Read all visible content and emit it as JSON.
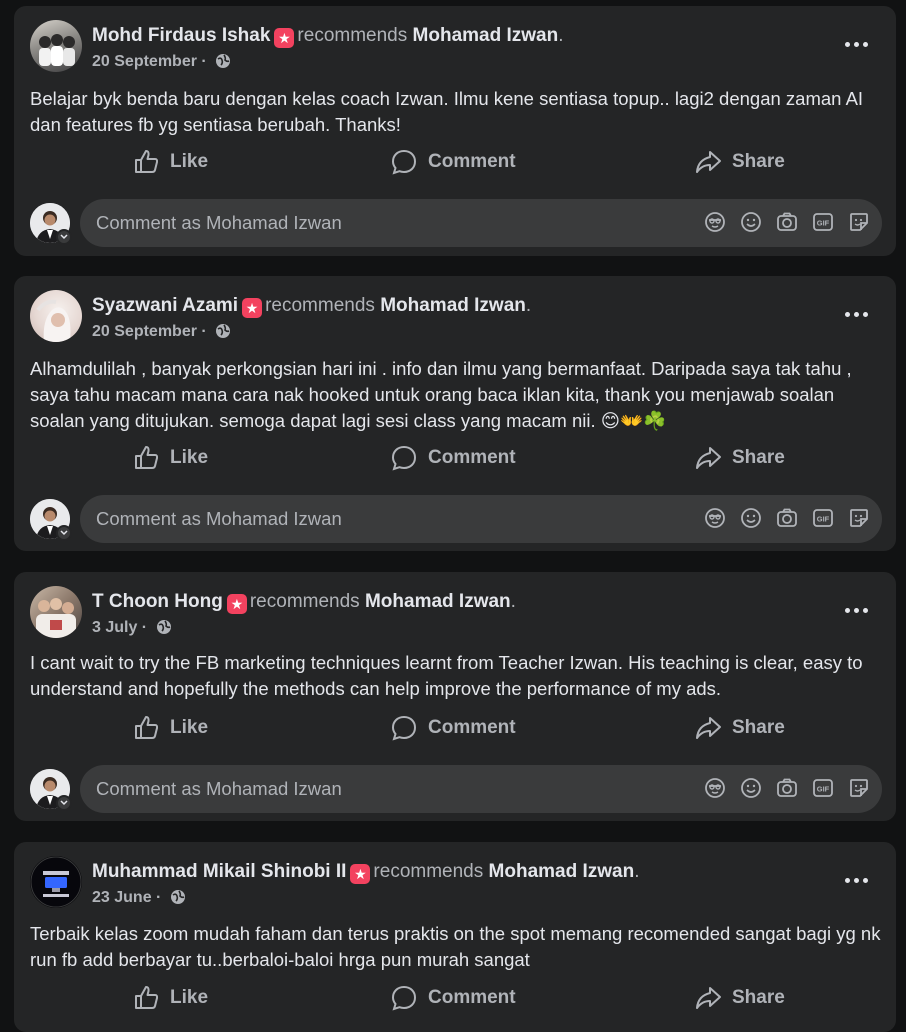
{
  "ui": {
    "recommends_text": "recommends",
    "like_label": "Like",
    "comment_label": "Comment",
    "share_label": "Share",
    "comment_placeholder": "Comment as Mohamad Izwan",
    "badge_icon": "star-icon",
    "privacy_icon": "globe-icon",
    "colors": {
      "background": "#111213",
      "card": "#242526",
      "input": "#3a3b3c",
      "primary_text": "#e4e6eb",
      "secondary_text": "#b0b3b8",
      "badge": "#f3425f"
    }
  },
  "posts": [
    {
      "author": "Mohd Firdaus Ishak",
      "target": "Mohamad Izwan",
      "date": "20 September",
      "text": "Belajar byk benda baru dengan kelas coach Izwan. Ilmu kene sentiasa topup.. lagi2 dengan zaman AI dan features fb yg sentiasa berubah. Thanks!"
    },
    {
      "author": "Syazwani Azami",
      "target": "Mohamad Izwan",
      "date": "20 September",
      "text": "Alhamdulilah , banyak perkongsian hari ini . info dan ilmu yang bermanfaat. Daripada saya tak tahu , saya tahu macam mana cara nak hooked untuk orang baca iklan kita, thank you menjawab soalan soalan yang ditujukan. semoga dapat lagi sesi class yang macam nii. 😊👐☘️"
    },
    {
      "author": "T Choon Hong",
      "target": "Mohamad Izwan",
      "date": "3 July",
      "text": "I cant wait to try the FB marketing techniques learnt from Teacher Izwan. His teaching is clear, easy to understand and hopefully the methods can help improve the performance of my ads."
    },
    {
      "author": "Muhammad Mikail Shinobi II",
      "target": "Mohamad Izwan",
      "date": "23 June",
      "text": "Terbaik kelas zoom mudah faham dan terus praktis on the spot memang recomended sangat bagi yg nk run fb add berbayar tu..berbaloi-baloi hrga pun murah sangat"
    }
  ]
}
